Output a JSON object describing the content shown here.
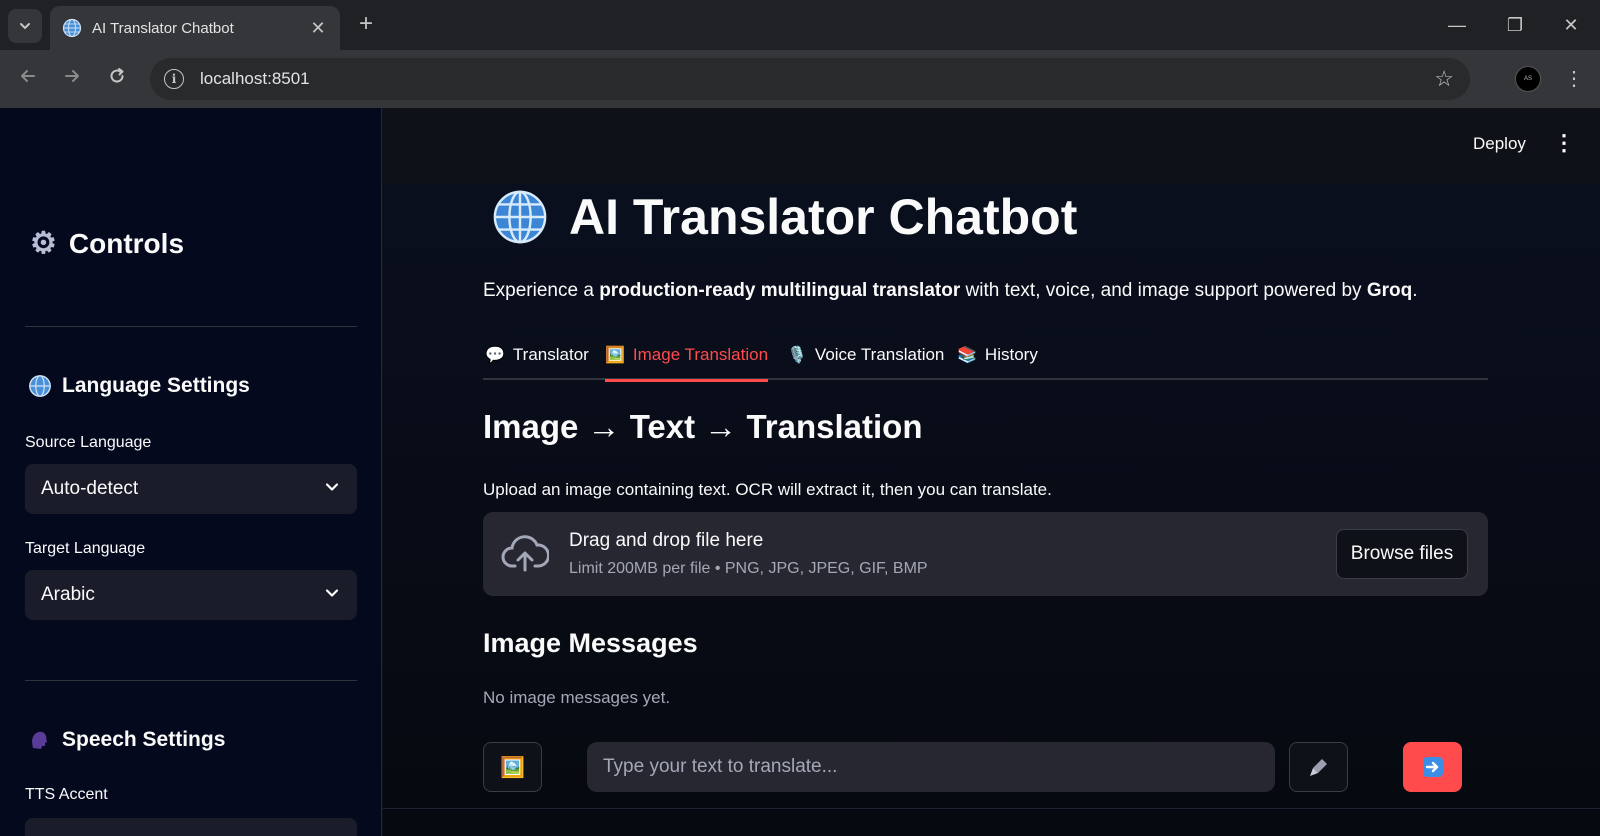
{
  "browser": {
    "tab_title": "AI Translator Chatbot",
    "tab_close": "✕",
    "new_tab": "+",
    "url": "localhost:8501",
    "profile_initials": "AS",
    "win_minimize": "—",
    "win_restore": "❐",
    "win_close": "✕"
  },
  "sidebar": {
    "title": "Controls",
    "language_section": "Language Settings",
    "source_label": "Source Language",
    "source_value": "Auto-detect",
    "target_label": "Target Language",
    "target_value": "Arabic",
    "speech_section": "Speech Settings",
    "tts_label": "TTS Accent"
  },
  "header": {
    "deploy": "Deploy"
  },
  "main": {
    "title": "AI Translator Chatbot",
    "subtitle_pre": "Experience a ",
    "subtitle_bold": "production-ready multilingual translator",
    "subtitle_mid": " with text, voice, and image support powered by ",
    "subtitle_brand": "Groq",
    "subtitle_end": ".",
    "tabs": [
      {
        "icon": "💬",
        "label": "Translator"
      },
      {
        "icon": "🖼️",
        "label": "Image Translation"
      },
      {
        "icon": "🎙️",
        "label": "Voice Translation"
      },
      {
        "icon": "📚",
        "label": "History"
      }
    ],
    "active_tab": "Image Translation",
    "section_title": "Image → Text → Translation",
    "section_desc": "Upload an image containing text. OCR will extract it, then you can translate.",
    "dropzone_title": "Drag and drop file here",
    "dropzone_limit": "Limit 200MB per file • PNG, JPG, JPEG, GIF, BMP",
    "browse_label": "Browse files",
    "messages_title": "Image Messages",
    "messages_empty": "No image messages yet.",
    "input_placeholder": "Type your text to translate..."
  },
  "colors": {
    "accent": "#ff4b4b",
    "background": "#0e1117",
    "sidebar": "#05091d"
  }
}
